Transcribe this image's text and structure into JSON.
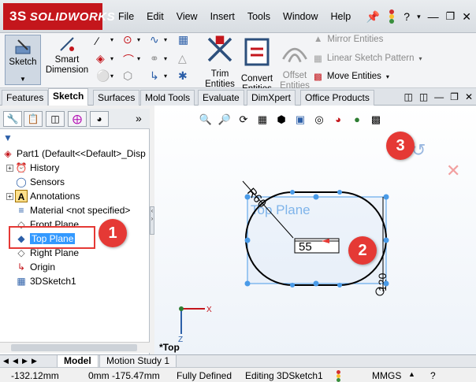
{
  "app": {
    "logo": "SOLIDWORKS",
    "logo_mark": "3S"
  },
  "menus": [
    "File",
    "Edit",
    "View",
    "Insert",
    "Tools",
    "Window",
    "Help"
  ],
  "titlebar_icons": {
    "pin": "pushpin-icon",
    "help": "?",
    "traffic": "traffic-light-icon"
  },
  "toolbar": {
    "sketch": "Sketch",
    "smart_dimension_1": "Smart",
    "smart_dimension_2": "Dimension",
    "trim_1": "Trim",
    "trim_2": "Entities",
    "convert_1": "Convert",
    "convert_2": "Entities",
    "offset_1": "Offset",
    "offset_2": "Entities",
    "mirror": "Mirror Entities",
    "linear_pattern": "Linear Sketch Pattern",
    "move": "Move Entities"
  },
  "tabs": [
    "Features",
    "Sketch",
    "Surfaces",
    "Mold Tools",
    "Evaluate",
    "DimXpert",
    "Office Products"
  ],
  "tree": {
    "root": "Part1  (Default<<Default>_Disp",
    "items": [
      "History",
      "Sensors",
      "Annotations",
      "Material <not specified>",
      "Front Plane",
      "Top Plane",
      "Right Plane",
      "Origin",
      "3DSketch1"
    ]
  },
  "badges": [
    "1",
    "2",
    "3"
  ],
  "graphics": {
    "plane_label": "Top Plane",
    "radius_dim": "R60",
    "length_dim": "55",
    "diameter_dim": "120",
    "view_label": "*Top"
  },
  "bottom_tabs": [
    "Model",
    "Motion Study 1"
  ],
  "status": {
    "x": "-132.12mm",
    "yz": "0mm  -175.47mm",
    "state": "Fully Defined",
    "editing": "Editing 3DSketch1",
    "units": "MMGS"
  },
  "colors": {
    "brand": "#c4161c",
    "badge": "#e53935",
    "selection": "#3399ff",
    "sketch_handle": "#4a9be8"
  }
}
